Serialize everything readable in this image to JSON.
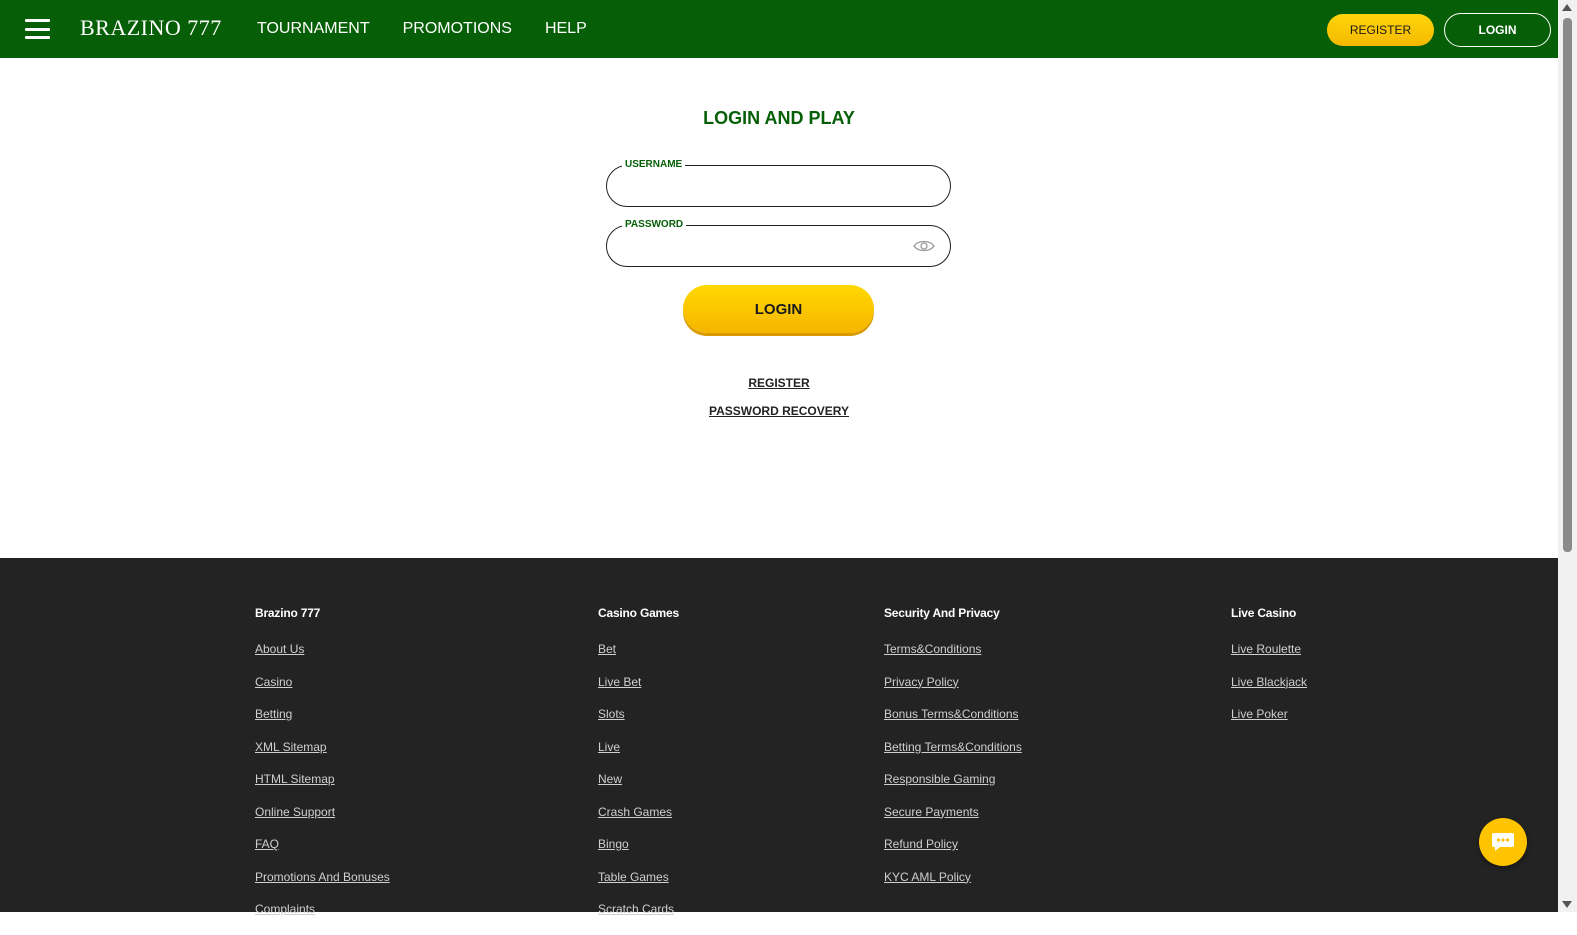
{
  "header": {
    "logo": "BRAZINO 777",
    "nav": [
      "TOURNAMENT",
      "PROMOTIONS",
      "HELP"
    ],
    "register_label": "REGISTER",
    "login_label": "LOGIN"
  },
  "login_form": {
    "title": "LOGIN AND PLAY",
    "username_label": "USERNAME",
    "username_value": "",
    "password_label": "PASSWORD",
    "password_value": "",
    "submit_label": "LOGIN",
    "register_link": "REGISTER",
    "recovery_link": "PASSWORD RECOVERY"
  },
  "footer": {
    "columns": [
      {
        "heading": "Brazino 777",
        "links": [
          "About Us",
          "Casino",
          "Betting",
          "XML Sitemap",
          "HTML Sitemap",
          "Online Support",
          "FAQ",
          "Promotions And Bonuses",
          "Complaints"
        ]
      },
      {
        "heading": "Casino Games",
        "links": [
          "Bet",
          "Live Bet",
          "Slots",
          "Live",
          "New",
          "Crash Games",
          "Bingo",
          "Table Games",
          "Scratch Cards"
        ]
      },
      {
        "heading": "Security And Privacy",
        "links": [
          "Terms&Conditions",
          "Privacy Policy",
          "Bonus Terms&Conditions",
          "Betting Terms&Conditions",
          "Responsible Gaming",
          "Secure Payments",
          "Refund Policy",
          "KYC AML Policy"
        ]
      },
      {
        "heading": "Live Casino",
        "links": [
          "Live Roulette",
          "Live Blackjack",
          "Live Poker"
        ]
      }
    ]
  },
  "colors": {
    "header_bg": "#065f06",
    "accent_yellow": "#ffc400",
    "footer_bg": "#232323"
  }
}
